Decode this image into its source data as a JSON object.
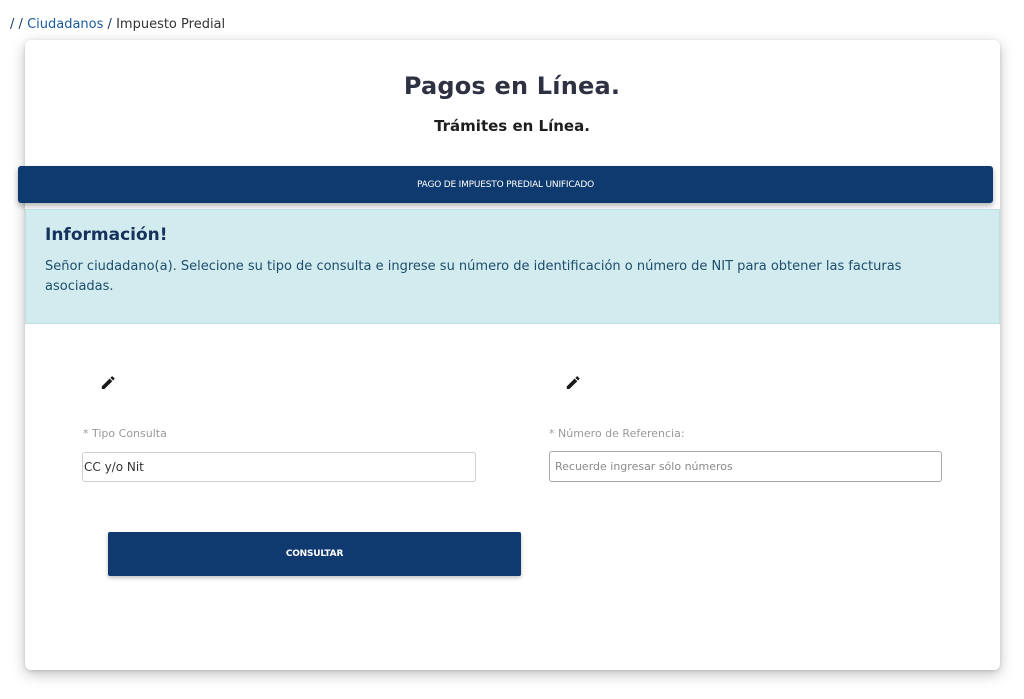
{
  "breadcrumb": {
    "separator": "/",
    "link": "Ciudadanos",
    "current": "Impuesto Predial"
  },
  "header": {
    "title": "Pagos en Línea.",
    "subtitle": "Trámites en Línea."
  },
  "banner": {
    "label": "PAGO DE IMPUESTO PREDIAL UNIFICADO"
  },
  "info": {
    "title": "Información!",
    "text": "Señor ciudadano(a). Selecione su tipo de consulta e ingrese su número de identificación o número de NIT para obtener las facturas asociadas."
  },
  "form": {
    "tipo_consulta": {
      "icon": "pencil-icon",
      "label": "* Tipo Consulta",
      "value": "CC y/o Nit"
    },
    "numero_referencia": {
      "icon": "pencil-icon",
      "label": "* Número de Referencia:",
      "placeholder": "Recuerde ingresar sólo números",
      "value": ""
    },
    "submit_label": "CONSULTAR"
  },
  "colors": {
    "primary": "#0f3a70",
    "info_bg": "#d1ebef",
    "info_title": "#16325c",
    "link": "#1a5a9c"
  }
}
